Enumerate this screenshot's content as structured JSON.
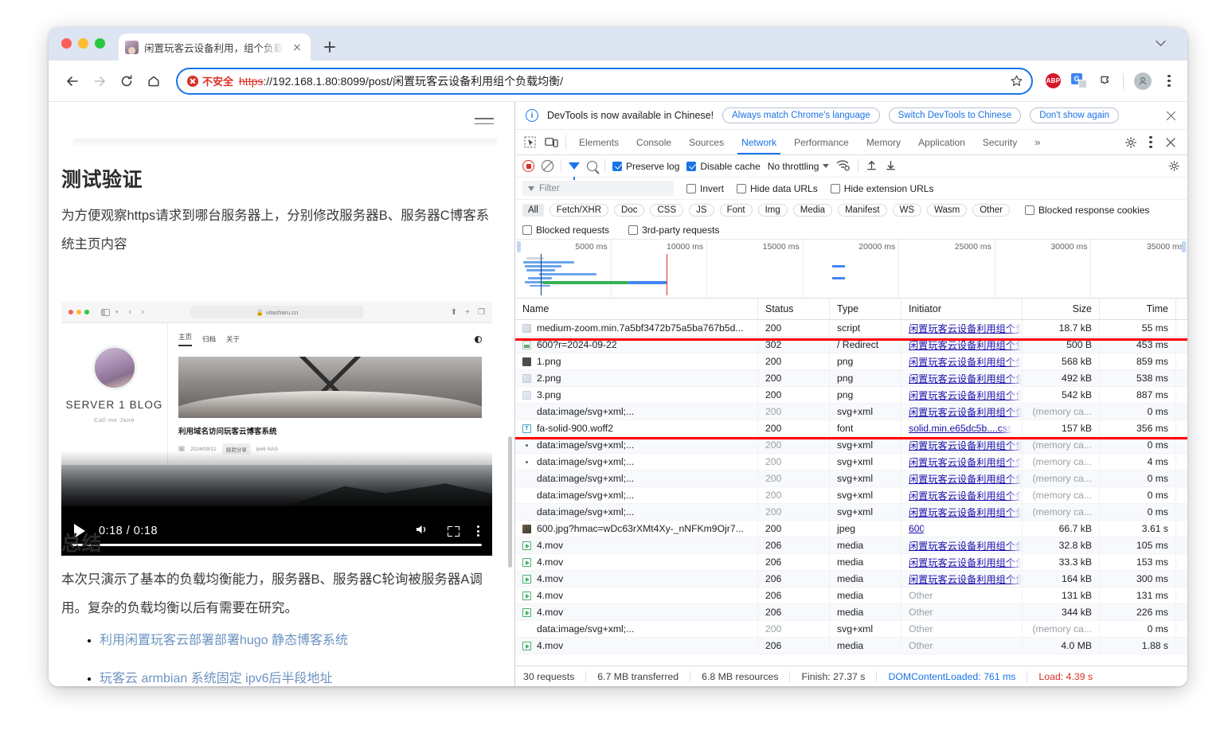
{
  "browser": {
    "tab": {
      "title": "闲置玩客云设备利用，组个负载均衡",
      "favicon": "avatar-favicon",
      "close_icon": "close-icon"
    },
    "new_tab_icon": "plus-icon",
    "tab_list_icon": "chevron-down-icon",
    "nav": {
      "back_icon": "back-arrow-icon",
      "forward_icon": "forward-arrow-icon",
      "reload_icon": "reload-icon",
      "home_icon": "home-icon"
    },
    "omnibox": {
      "security_label": "不安全",
      "security_icon": "not-secure-icon",
      "url_scheme": "https",
      "url_rest": "://192.168.1.80:8099/post/闲置玩客云设备利用组个负载均衡/",
      "bookmark_icon": "star-icon"
    },
    "extensions": {
      "adblock_label": "ABP",
      "translate_icon": "google-translate-icon",
      "puzzle_icon": "extensions-puzzle-icon",
      "profile_icon": "profile-avatar",
      "menu_icon": "three-dot-menu-icon"
    }
  },
  "page": {
    "menu_icon": "hamburger-menu-icon",
    "heading_1": "测试验证",
    "paragraph_1": "为方便观察https请求到哪台服务器上，分别修改服务器B、服务器C博客系统主页内容",
    "heading_2": "总结",
    "paragraph_2": "本次只演示了基本的负载均衡能力，服务器B、服务器C轮询被服务器A调用。复杂的负载均衡以后有需要在研究。",
    "links": [
      "利用闲置玩客云部署部署hugo 静态博客系统",
      "玩客云 armbian 系统固定 ipv6后半段地址"
    ],
    "video": {
      "play_icon": "play-icon",
      "time": "0:18 / 0:18",
      "volume_icon": "volume-icon",
      "fullscreen_icon": "fullscreen-icon",
      "more_icon": "more-options-icon",
      "inner": {
        "url": "vitasharu.cn",
        "lock_icon": "lock-icon",
        "reload_icon": "reload-icon",
        "menu": [
          "主页",
          "归档",
          "关于"
        ],
        "theme_icon": "theme-toggle-icon",
        "blog_title": "SERVER 1 BLOG",
        "blog_sub": "Call me Jane",
        "post_title": "利用域名访问玩客云博客系统",
        "post_date": "2024/09/12",
        "post_tag": "经验分享",
        "post_tags_more": "ipv6  NAS",
        "share_icon": "share-icon",
        "plus_icon": "plus-icon",
        "tabs_icon": "tabs-icon"
      }
    }
  },
  "devtools": {
    "banner": {
      "info_icon": "info-icon",
      "text": "DevTools is now available in Chinese!",
      "buttons": [
        "Always match Chrome's language",
        "Switch DevTools to Chinese",
        "Don't show again"
      ],
      "close_icon": "close-icon"
    },
    "panel_tabs": {
      "inspect_icon": "inspect-element-icon",
      "device_icon": "device-toolbar-icon",
      "items": [
        "Elements",
        "Console",
        "Sources",
        "Network",
        "Performance",
        "Memory",
        "Application",
        "Security"
      ],
      "active": "Network",
      "more_icon": "more-tabs-icon",
      "settings_icon": "gear-icon",
      "kebab_icon": "three-dot-menu-icon",
      "close_icon": "close-icon"
    },
    "toolbar": {
      "record_icon": "record-stop-icon",
      "clear_icon": "clear-icon",
      "filter_icon": "filter-funnel-icon",
      "search_icon": "search-icon",
      "preserve_log": {
        "label": "Preserve log",
        "checked": true
      },
      "disable_cache": {
        "label": "Disable cache",
        "checked": true
      },
      "throttling": "No throttling",
      "throttle_caret_icon": "chevron-down-icon",
      "wifi_icon": "network-conditions-icon",
      "import_icon": "import-har-icon",
      "export_icon": "export-har-icon",
      "settings_icon": "gear-icon"
    },
    "filter_row": {
      "filter_icon": "filter-funnel-icon",
      "placeholder": "Filter",
      "invert": {
        "label": "Invert",
        "checked": false
      },
      "hide_data_urls": {
        "label": "Hide data URLs",
        "checked": false
      },
      "hide_extension_urls": {
        "label": "Hide extension URLs",
        "checked": false
      }
    },
    "type_filters": [
      "All",
      "Fetch/XHR",
      "Doc",
      "CSS",
      "JS",
      "Font",
      "Img",
      "Media",
      "Manifest",
      "WS",
      "Wasm",
      "Other"
    ],
    "type_active": "All",
    "blocked_response_cookies": {
      "label": "Blocked response cookies",
      "checked": false
    },
    "blocked_requests": {
      "label": "Blocked requests",
      "checked": false
    },
    "third_party_requests": {
      "label": "3rd-party requests",
      "checked": false
    },
    "overview_ticks": [
      "5000 ms",
      "10000 ms",
      "15000 ms",
      "20000 ms",
      "25000 ms",
      "30000 ms",
      "35000 ms"
    ],
    "columns": [
      "Name",
      "Status",
      "Type",
      "Initiator",
      "Size",
      "Time"
    ],
    "rows": [
      {
        "icon": "script-icon",
        "name": "medium-zoom.min.7a5bf3472b75a5ba767b5d...",
        "status": "200",
        "type": "script",
        "initiator": "闲置玩客云设备利用组个负",
        "initiator_link": true,
        "size": "18.7 kB",
        "time": "55 ms",
        "dim": false,
        "highlight": true
      },
      {
        "icon": "doc-icon",
        "name": "600?r=2024-09-22",
        "status": "302",
        "type": "/ Redirect",
        "initiator": "闲置玩客云设备利用组个负",
        "initiator_link": true,
        "size": "500 B",
        "time": "453 ms",
        "dim": false,
        "highlight": true
      },
      {
        "icon": "png-icon",
        "name": "1.png",
        "status": "200",
        "type": "png",
        "initiator": "闲置玩客云设备利用组个负",
        "initiator_link": true,
        "size": "568 kB",
        "time": "859 ms",
        "dim": false,
        "highlight": true
      },
      {
        "icon": "png-icon-2",
        "name": "2.png",
        "status": "200",
        "type": "png",
        "initiator": "闲置玩客云设备利用组个负",
        "initiator_link": true,
        "size": "492 kB",
        "time": "538 ms",
        "dim": false,
        "highlight": true
      },
      {
        "icon": "png-icon-3",
        "name": "3.png",
        "status": "200",
        "type": "png",
        "initiator": "闲置玩客云设备利用组个负",
        "initiator_link": true,
        "size": "542 kB",
        "time": "887 ms",
        "dim": false,
        "highlight": true
      },
      {
        "icon": "svg-icon",
        "name": "data:image/svg+xml;...",
        "status": "200",
        "type": "svg+xml",
        "initiator": "闲置玩客云设备利用组个负",
        "initiator_link": true,
        "size": "(memory ca...",
        "time": "0 ms",
        "dim": true,
        "highlight": true
      },
      {
        "icon": "font-icon",
        "name": "fa-solid-900.woff2",
        "status": "200",
        "type": "font",
        "initiator": "solid.min.e65dc5b....css",
        "initiator_link": true,
        "size": "157 kB",
        "time": "356 ms",
        "dim": false
      },
      {
        "icon": "dot-icon",
        "name": "data:image/svg+xml;...",
        "status": "200",
        "type": "svg+xml",
        "initiator": "闲置玩客云设备利用组个负",
        "initiator_link": true,
        "size": "(memory ca...",
        "time": "0 ms",
        "dim": true
      },
      {
        "icon": "dot-icon",
        "name": "data:image/svg+xml;...",
        "status": "200",
        "type": "svg+xml",
        "initiator": "闲置玩客云设备利用组个负",
        "initiator_link": true,
        "size": "(memory ca...",
        "time": "4 ms",
        "dim": true
      },
      {
        "icon": "blank-icon",
        "name": "data:image/svg+xml;...",
        "status": "200",
        "type": "svg+xml",
        "initiator": "闲置玩客云设备利用组个负",
        "initiator_link": true,
        "size": "(memory ca...",
        "time": "0 ms",
        "dim": true
      },
      {
        "icon": "blank-icon",
        "name": "data:image/svg+xml;...",
        "status": "200",
        "type": "svg+xml",
        "initiator": "闲置玩客云设备利用组个负",
        "initiator_link": true,
        "size": "(memory ca...",
        "time": "0 ms",
        "dim": true
      },
      {
        "icon": "blank-icon",
        "name": "data:image/svg+xml;...",
        "status": "200",
        "type": "svg+xml",
        "initiator": "闲置玩客云设备利用组个负",
        "initiator_link": true,
        "size": "(memory ca...",
        "time": "0 ms",
        "dim": true
      },
      {
        "icon": "jpeg-icon",
        "name": "600.jpg?hmac=wDc63rXMt4Xy-_nNFKm9Ojr7...",
        "status": "200",
        "type": "jpeg",
        "initiator": "600",
        "initiator_link": true,
        "size": "66.7 kB",
        "time": "3.61 s",
        "dim": false
      },
      {
        "icon": "media-icon",
        "name": "4.mov",
        "status": "206",
        "type": "media",
        "initiator": "闲置玩客云设备利用组个负",
        "initiator_link": true,
        "size": "32.8 kB",
        "time": "105 ms",
        "dim": false
      },
      {
        "icon": "media-icon",
        "name": "4.mov",
        "status": "206",
        "type": "media",
        "initiator": "闲置玩客云设备利用组个负",
        "initiator_link": true,
        "size": "33.3 kB",
        "time": "153 ms",
        "dim": false
      },
      {
        "icon": "media-icon",
        "name": "4.mov",
        "status": "206",
        "type": "media",
        "initiator": "闲置玩客云设备利用组个负",
        "initiator_link": true,
        "size": "164 kB",
        "time": "300 ms",
        "dim": false
      },
      {
        "icon": "media-icon",
        "name": "4.mov",
        "status": "206",
        "type": "media",
        "initiator": "Other",
        "initiator_link": false,
        "size": "131 kB",
        "time": "131 ms",
        "dim": false
      },
      {
        "icon": "media-icon",
        "name": "4.mov",
        "status": "206",
        "type": "media",
        "initiator": "Other",
        "initiator_link": false,
        "size": "344 kB",
        "time": "226 ms",
        "dim": false
      },
      {
        "icon": "blank-icon",
        "name": "data:image/svg+xml;...",
        "status": "200",
        "type": "svg+xml",
        "initiator": "Other",
        "initiator_link": false,
        "size": "(memory ca...",
        "time": "0 ms",
        "dim": true
      },
      {
        "icon": "media-icon",
        "name": "4.mov",
        "status": "206",
        "type": "media",
        "initiator": "Other",
        "initiator_link": false,
        "size": "4.0 MB",
        "time": "1.88 s",
        "dim": false
      }
    ],
    "status_bar": {
      "requests": "30 requests",
      "transferred": "6.7 MB transferred",
      "resources": "6.8 MB resources",
      "finish": "Finish: 27.37 s",
      "dom_content_loaded": "DOMContentLoaded: 761 ms",
      "load": "Load: 4.39 s"
    },
    "colors": {
      "accent": "#1a73e8",
      "error": "#d93025",
      "highlight_box": "#ff0000",
      "link": "#1a0dab"
    }
  }
}
